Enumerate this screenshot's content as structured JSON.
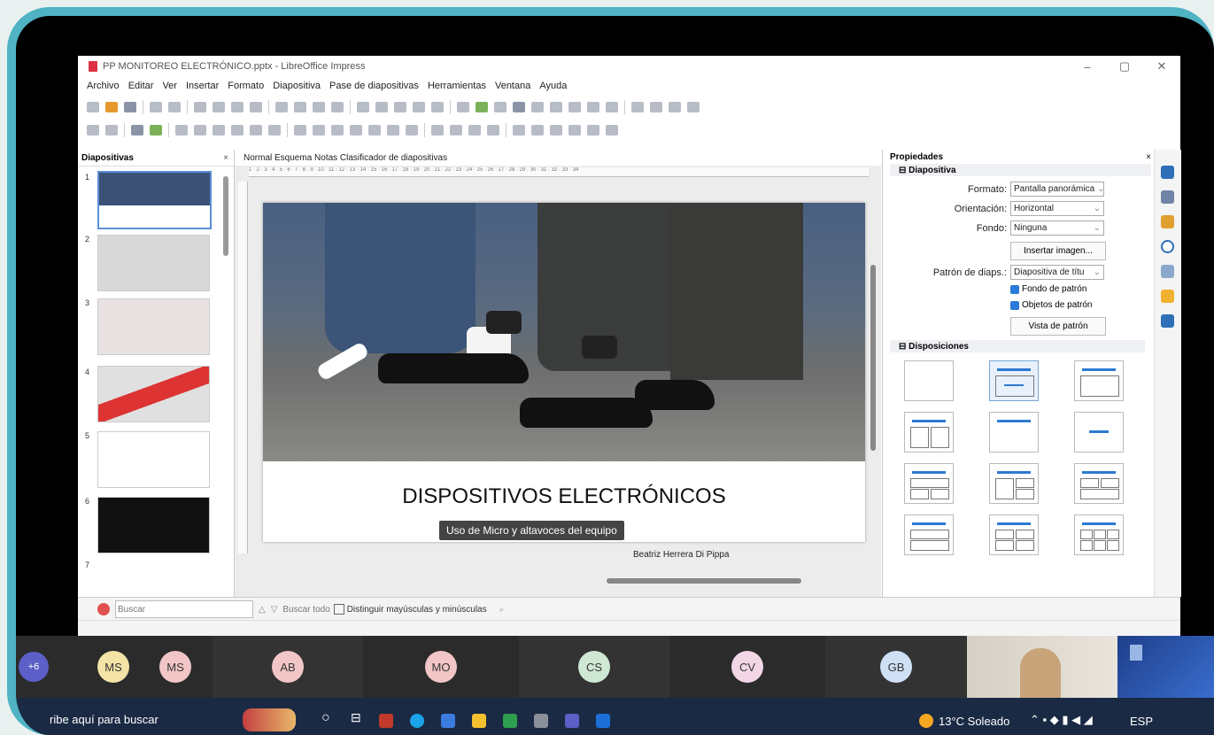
{
  "window": {
    "title": "PP MONITOREO ELECTRÓNICO.pptx - LibreOffice Impress",
    "controls": [
      "–",
      "▢",
      "✕"
    ]
  },
  "menu": [
    "Archivo",
    "Editar",
    "Ver",
    "Insertar",
    "Formato",
    "Diapositiva",
    "Pase de diapositivas",
    "Herramientas",
    "Ventana",
    "Ayuda"
  ],
  "slides_panel": {
    "title": "Diapositivas",
    "close": "×",
    "numbers": [
      "1",
      "2",
      "3",
      "4",
      "5",
      "6",
      "7"
    ]
  },
  "view_tabs": "Normal Esquema Notas Clasificador de diapositivas",
  "ruler": "1 · 2 · 3 · 4 · 5 · 6 · 7 · 8 · 9 · 10 · 11 · 12 · 13 · 14 · 15 · 16 · 17 · 18 · 19 · 20 · 21 · 22 · 23 · 24 · 25 · 26 · 27 · 28 · 29 · 30 · 31 · 32 · 33 · 34",
  "slide": {
    "title": "DISPOSITIVOS ELECTRÓNICOS",
    "author": "Beatriz Herrera Di Pippa"
  },
  "tooltip": "Uso de Micro y altavoces del equipo",
  "properties": {
    "title": "Propiedades",
    "close": "×",
    "section_slide": "Diapositiva",
    "format_label": "Formato:",
    "format_value": "Pantalla panorámica",
    "orientation_label": "Orientación:",
    "orientation_value": "Horizontal",
    "background_label": "Fondo:",
    "background_value": "Ninguna",
    "insert_image": "Insertar imagen...",
    "master_label": "Patrón de diaps.:",
    "master_value": "Diapositiva de títu",
    "master_background": "Fondo de patrón",
    "master_objects": "Objetos de patrón",
    "master_view": "Vista de patrón",
    "section_layouts": "Disposiciones"
  },
  "find": {
    "placeholder": "Buscar",
    "find_all": "Buscar todo",
    "match_case": "Distinguir mayúsculas y minúsculas"
  },
  "participants": {
    "more": "+6",
    "list": [
      {
        "initials": "MS",
        "color": "#f3e3a6"
      },
      {
        "initials": "MS",
        "color": "#f2c6c6"
      },
      {
        "initials": "AB",
        "color": "#f2c6c6"
      },
      {
        "initials": "MO",
        "color": "#f2c6c6"
      },
      {
        "initials": "CS",
        "color": "#cfe8d4"
      },
      {
        "initials": "CV",
        "color": "#f2d6e6"
      },
      {
        "initials": "GB",
        "color": "#cfe0f5"
      }
    ]
  },
  "taskbar": {
    "search": "ribe aquí para buscar",
    "weather": "13°C Soleado",
    "lang": "ESP"
  }
}
